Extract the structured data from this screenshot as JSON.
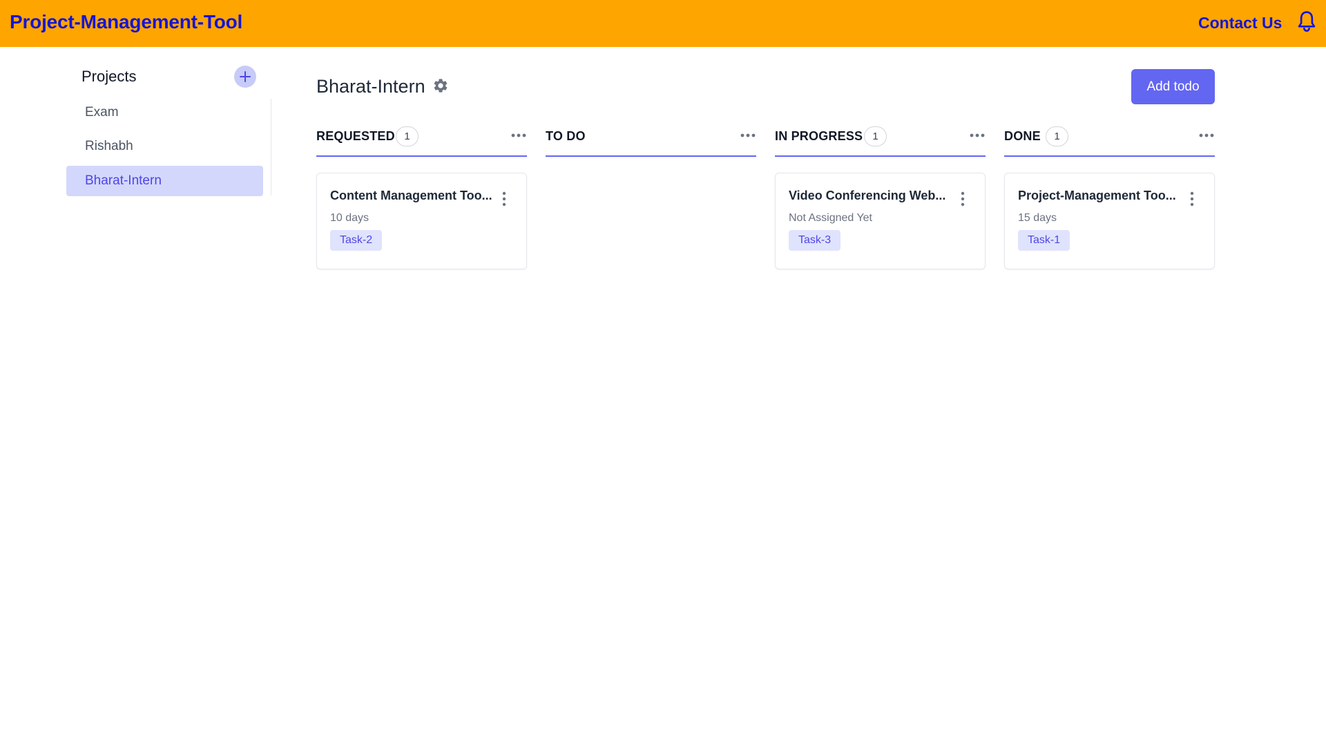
{
  "header": {
    "brand": "Project-Management-Tool",
    "contact_label": "Contact Us",
    "bell_icon": "bell-icon",
    "background": "#ffa500",
    "link_color": "#1515d6"
  },
  "sidebar": {
    "title": "Projects",
    "add_icon": "plus-icon",
    "items": [
      {
        "label": "Exam",
        "active": false
      },
      {
        "label": "Rishabh",
        "active": false
      },
      {
        "label": "Bharat-Intern",
        "active": true
      }
    ]
  },
  "board": {
    "title": "Bharat-Intern",
    "settings_icon": "gear-icon",
    "add_todo_label": "Add todo",
    "accent": "#6366f1",
    "columns": [
      {
        "title": "REQUESTED",
        "count": "1",
        "card": {
          "title": "Content Management Too...",
          "subtitle": "10 days",
          "tag": "Task-2"
        }
      },
      {
        "title": "TO DO",
        "count": null,
        "card": null
      },
      {
        "title": "IN PROGRESS",
        "count": "1",
        "card": {
          "title": "Video Conferencing Web...",
          "subtitle": "Not Assigned Yet",
          "tag": "Task-3"
        }
      },
      {
        "title": "DONE",
        "count": "1",
        "card": {
          "title": "Project-Management Too...",
          "subtitle": "15 days",
          "tag": "Task-1"
        }
      }
    ]
  }
}
